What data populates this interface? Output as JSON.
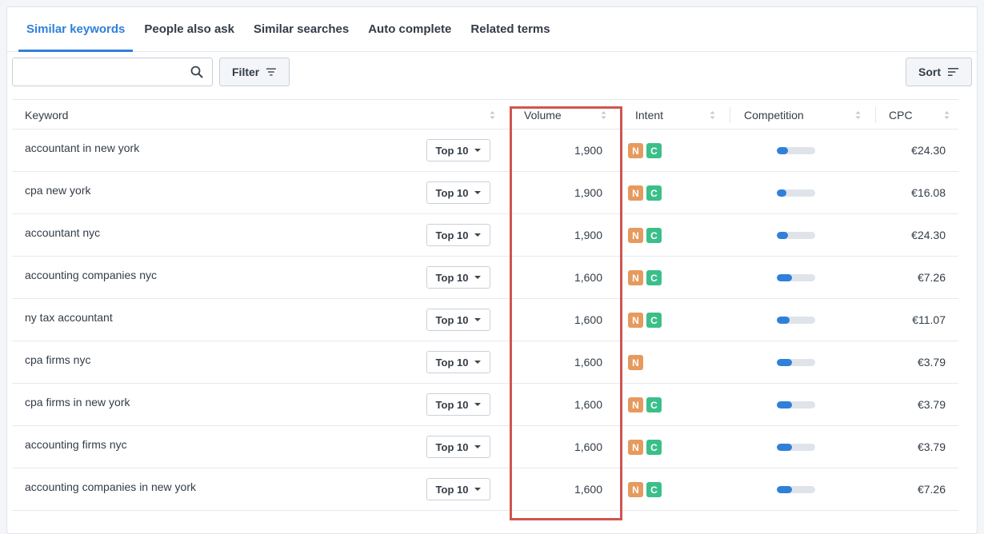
{
  "tabs": [
    {
      "label": "Similar keywords",
      "active": true
    },
    {
      "label": "People also ask",
      "active": false
    },
    {
      "label": "Similar searches",
      "active": false
    },
    {
      "label": "Auto complete",
      "active": false
    },
    {
      "label": "Related terms",
      "active": false
    }
  ],
  "toolbar": {
    "search_value": "",
    "search_placeholder": "",
    "filter_label": "Filter",
    "sort_label": "Sort"
  },
  "columns": {
    "keyword": "Keyword",
    "volume": "Volume",
    "intent": "Intent",
    "competition": "Competition",
    "cpc": "CPC"
  },
  "colors": {
    "accent": "#2f80d9",
    "badge_n": "#e69a5e",
    "badge_c": "#3bbf8a",
    "highlight": "#d0554f"
  },
  "rows": [
    {
      "keyword": "accountant in new york",
      "serp": "Top 10",
      "volume": "1,900",
      "intents": [
        "N",
        "C"
      ],
      "competition": 0.3,
      "cpc": "€24.30"
    },
    {
      "keyword": "cpa new york",
      "serp": "Top 10",
      "volume": "1,900",
      "intents": [
        "N",
        "C"
      ],
      "competition": 0.25,
      "cpc": "€16.08"
    },
    {
      "keyword": "accountant nyc",
      "serp": "Top 10",
      "volume": "1,900",
      "intents": [
        "N",
        "C"
      ],
      "competition": 0.3,
      "cpc": "€24.30"
    },
    {
      "keyword": "accounting companies nyc",
      "serp": "Top 10",
      "volume": "1,600",
      "intents": [
        "N",
        "C"
      ],
      "competition": 0.4,
      "cpc": "€7.26"
    },
    {
      "keyword": "ny tax accountant",
      "serp": "Top 10",
      "volume": "1,600",
      "intents": [
        "N",
        "C"
      ],
      "competition": 0.33,
      "cpc": "€11.07"
    },
    {
      "keyword": "cpa firms nyc",
      "serp": "Top 10",
      "volume": "1,600",
      "intents": [
        "N"
      ],
      "competition": 0.4,
      "cpc": "€3.79"
    },
    {
      "keyword": "cpa firms in new york",
      "serp": "Top 10",
      "volume": "1,600",
      "intents": [
        "N",
        "C"
      ],
      "competition": 0.4,
      "cpc": "€3.79"
    },
    {
      "keyword": "accounting firms nyc",
      "serp": "Top 10",
      "volume": "1,600",
      "intents": [
        "N",
        "C"
      ],
      "competition": 0.4,
      "cpc": "€3.79"
    },
    {
      "keyword": "accounting companies in new york",
      "serp": "Top 10",
      "volume": "1,600",
      "intents": [
        "N",
        "C"
      ],
      "competition": 0.4,
      "cpc": "€7.26"
    }
  ]
}
